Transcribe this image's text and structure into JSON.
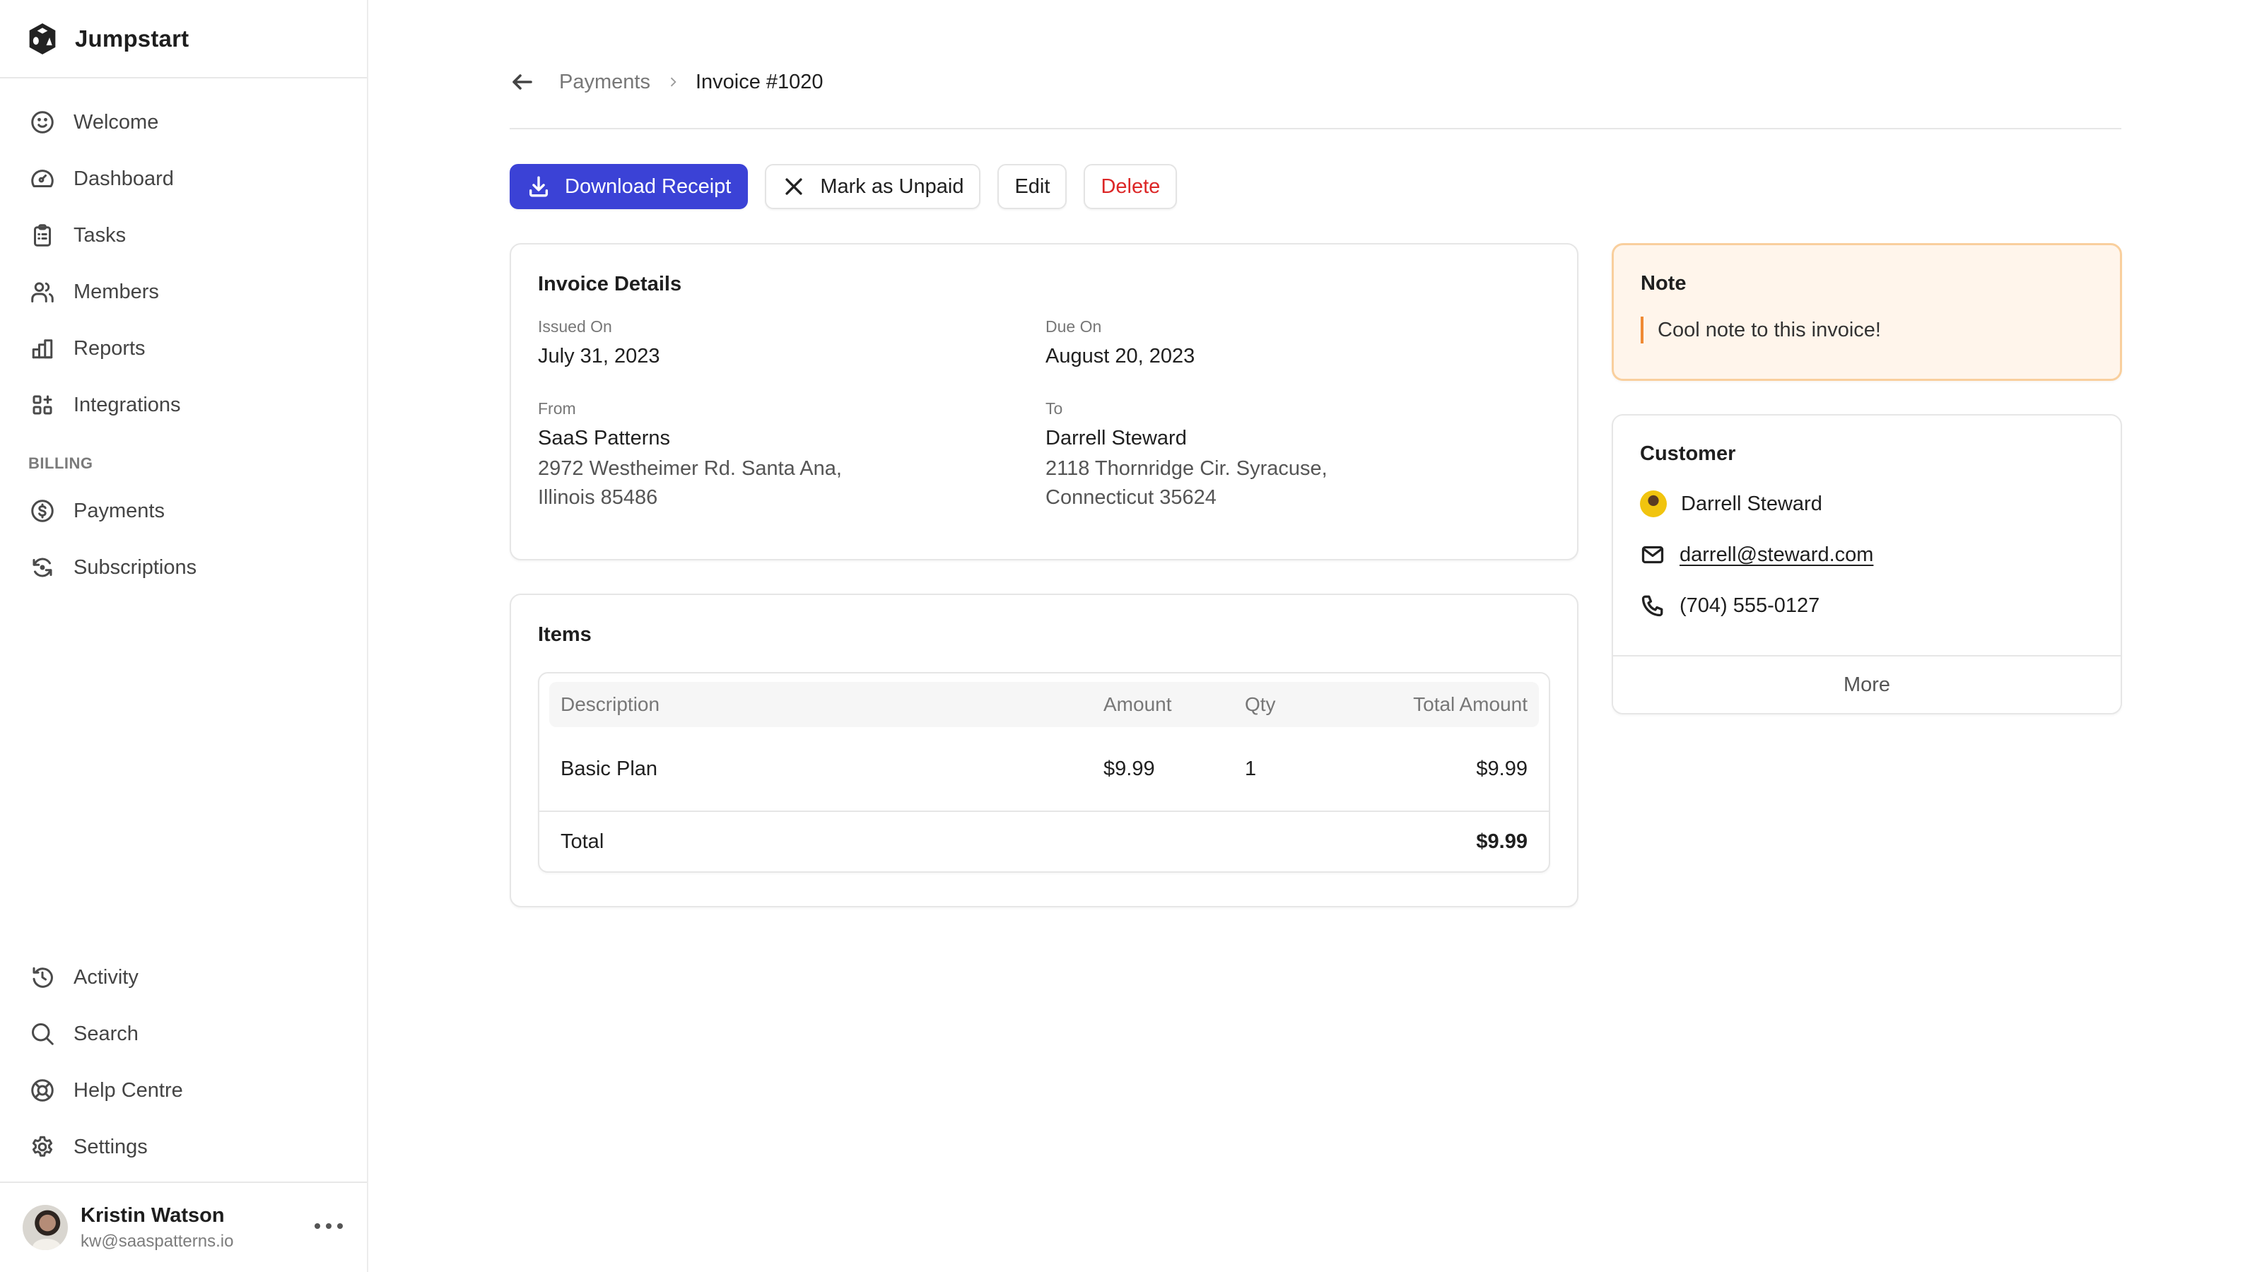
{
  "app": {
    "name": "Jumpstart"
  },
  "sidebar": {
    "items": [
      {
        "label": "Welcome",
        "icon": "smile-icon"
      },
      {
        "label": "Dashboard",
        "icon": "gauge-icon"
      },
      {
        "label": "Tasks",
        "icon": "clipboard-icon"
      },
      {
        "label": "Members",
        "icon": "users-icon"
      },
      {
        "label": "Reports",
        "icon": "bar-chart-icon"
      },
      {
        "label": "Integrations",
        "icon": "apps-plus-icon"
      }
    ],
    "billing_label": "BILLING",
    "billing_items": [
      {
        "label": "Payments",
        "icon": "dollar-circle-icon"
      },
      {
        "label": "Subscriptions",
        "icon": "refresh-icon"
      }
    ],
    "bottom_items": [
      {
        "label": "Activity",
        "icon": "history-icon"
      },
      {
        "label": "Search",
        "icon": "search-icon"
      },
      {
        "label": "Help Centre",
        "icon": "lifebuoy-icon"
      },
      {
        "label": "Settings",
        "icon": "gear-icon"
      }
    ],
    "user": {
      "name": "Kristin Watson",
      "email": "kw@saaspatterns.io"
    }
  },
  "breadcrumb": {
    "parent": "Payments",
    "current": "Invoice #1020"
  },
  "actions": {
    "download": "Download Receipt",
    "mark_unpaid": "Mark as Unpaid",
    "edit": "Edit",
    "delete": "Delete"
  },
  "invoice_details": {
    "title": "Invoice Details",
    "issued_label": "Issued On",
    "issued_value": "July 31, 2023",
    "due_label": "Due On",
    "due_value": "August 20, 2023",
    "from_label": "From",
    "from_name": "SaaS Patterns",
    "from_address_1": "2972 Westheimer Rd. Santa Ana,",
    "from_address_2": "Illinois 85486",
    "to_label": "To",
    "to_name": "Darrell Steward",
    "to_address_1": "2118 Thornridge Cir. Syracuse,",
    "to_address_2": "Connecticut 35624"
  },
  "items": {
    "title": "Items",
    "columns": [
      "Description",
      "Amount",
      "Qty",
      "Total Amount"
    ],
    "rows": [
      {
        "description": "Basic Plan",
        "amount": "$9.99",
        "qty": "1",
        "total": "$9.99"
      }
    ],
    "total_label": "Total",
    "total_value": "$9.99"
  },
  "note": {
    "title": "Note",
    "text": "Cool note to this invoice!"
  },
  "customer": {
    "title": "Customer",
    "name": "Darrell Steward",
    "email": "darrell@steward.com",
    "phone": "(704) 555-0127",
    "more_label": "More"
  },
  "colors": {
    "primary": "#3b42d6",
    "danger": "#dc2626",
    "note_bg": "#fff5eb",
    "note_border": "#f9cf9d",
    "note_accent": "#ef8a34"
  }
}
